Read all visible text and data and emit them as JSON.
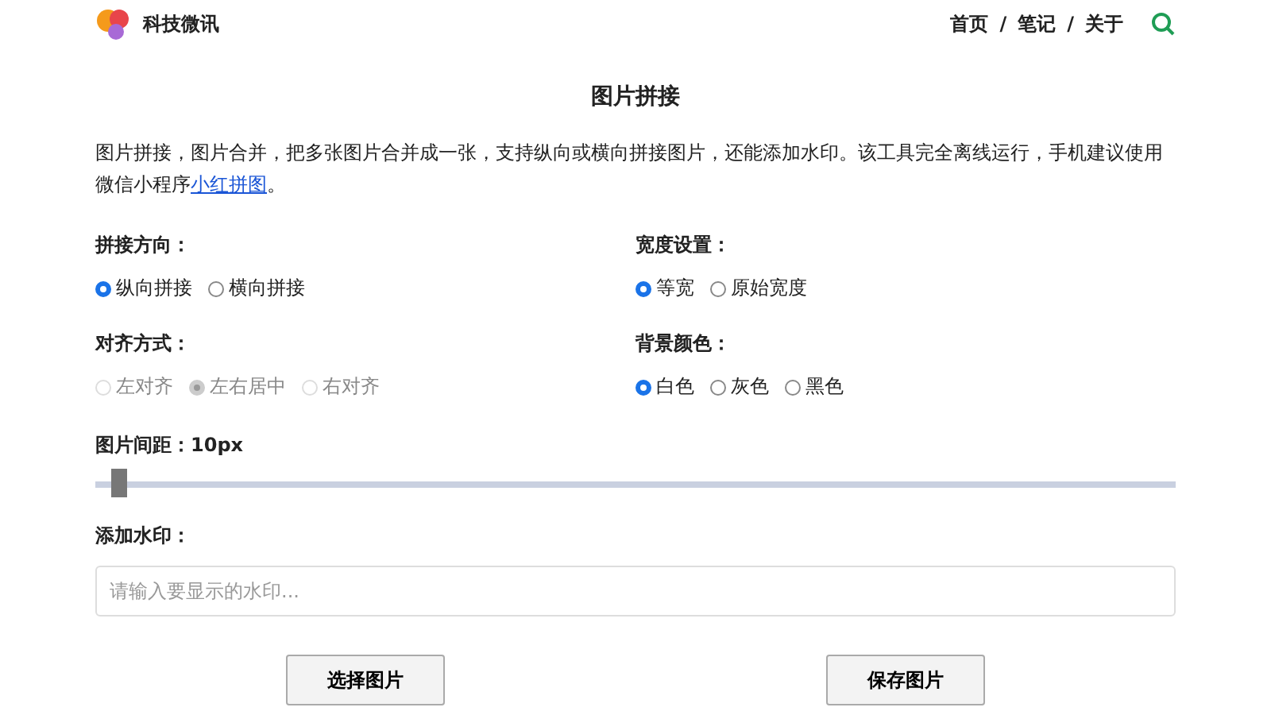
{
  "header": {
    "site_name": "科技微讯",
    "nav": [
      "首页",
      "笔记",
      "关于"
    ],
    "separator": "/"
  },
  "title": "图片拼接",
  "description": {
    "before": "图片拼接，图片合并，把多张图片合并成一张，支持纵向或横向拼接图片，还能添加水印。该工具完全离线运行，手机建议使用微信小程序",
    "link": "小红拼图",
    "after": "。"
  },
  "options": [
    {
      "label": "拼接方向：",
      "disabled": false,
      "choices": [
        {
          "label": "纵向拼接",
          "selected": true
        },
        {
          "label": "横向拼接",
          "selected": false
        }
      ]
    },
    {
      "label": "宽度设置：",
      "disabled": false,
      "choices": [
        {
          "label": "等宽",
          "selected": true
        },
        {
          "label": "原始宽度",
          "selected": false
        }
      ]
    },
    {
      "label": "对齐方式：",
      "disabled": true,
      "choices": [
        {
          "label": "左对齐",
          "selected": false
        },
        {
          "label": "左右居中",
          "selected": true
        },
        {
          "label": "右对齐",
          "selected": false
        }
      ]
    },
    {
      "label": "背景颜色：",
      "disabled": false,
      "choices": [
        {
          "label": "白色",
          "selected": true
        },
        {
          "label": "灰色",
          "selected": false
        },
        {
          "label": "黑色",
          "selected": false
        }
      ]
    }
  ],
  "spacing": {
    "label": "图片间距：10px",
    "level": 0.015
  },
  "watermark": {
    "label": "添加水印：",
    "placeholder": "请输入要显示的水印..."
  },
  "buttons": [
    "选择图片",
    "保存图片"
  ]
}
